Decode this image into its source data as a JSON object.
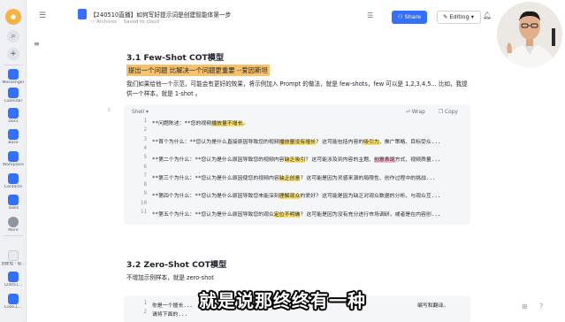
{
  "rail": {
    "items": [
      {
        "label": "Messenger",
        "color": "#3370ff"
      },
      {
        "label": "Calendar",
        "color": "#3370ff"
      },
      {
        "label": "Docs",
        "color": "#3370ff"
      },
      {
        "label": "Base",
        "color": "#3370ff"
      },
      {
        "label": "Workplace",
        "color": "#3370ff"
      },
      {
        "label": "Contacts",
        "color": "#3370ff"
      },
      {
        "label": "Tasks",
        "color": "#3370ff"
      },
      {
        "label": "More",
        "color": "#3370ff"
      }
    ],
    "bottom": [
      {
        "label": "创建电 - 提..."
      },
      {
        "label": "[24051..."
      },
      {
        "label": "Coze工..."
      }
    ]
  },
  "header": {
    "title": "【240510直播】如何写好提示词是创建智能体第一步",
    "breadcrumb": "Archives",
    "saved": "Saved to cloud",
    "share_label": "Share",
    "editing_label": "Editing"
  },
  "doc": {
    "h31": "3.1 Few-Shot COT模型",
    "highlight": "提出一个问题 比解决一个问题更重要 --爱因斯坦",
    "para1": "我们如果给他一个示范，可能会有更好的效果，将示例加入 Prompt 的做法，就是 few-shots，few 可以是 1,2,3,4,5... 比如，我提供一个样本，就是 1-shot 。",
    "code": {
      "lang": "Shell",
      "wrap": "Wrap",
      "copy": "Copy",
      "lines": [
        {
          "n": "1",
          "segs": [
            [
              "t",
              "**问题陈述：**您的视频"
            ],
            [
              "y",
              "播放量不增长"
            ],
            [
              "t",
              "。"
            ]
          ]
        },
        {
          "n": "2",
          "segs": []
        },
        {
          "n": "3",
          "segs": [
            [
              "t",
              "**首个为什么：**您认为是什么直接原因导致您的视频"
            ],
            [
              "y",
              "播放量没有增长"
            ],
            [
              "t",
              "? 这可能包括内容的"
            ],
            [
              "y",
              "吸引力"
            ],
            [
              "t",
              "、推广策略、目标受众..."
            ]
          ]
        },
        {
          "n": "4",
          "segs": []
        },
        {
          "n": "5",
          "segs": [
            [
              "t",
              "**第二个为什么：**您认为是什么原因导致您的视频内容"
            ],
            [
              "y",
              "缺乏吸引"
            ],
            [
              "t",
              "? 这可能涉及到内容的主题、"
            ],
            [
              "p",
              "创意表现"
            ],
            [
              "t",
              "方式、视频质量..."
            ]
          ]
        },
        {
          "n": "6",
          "segs": []
        },
        {
          "n": "7",
          "segs": [
            [
              "t",
              "**第三个为什么：**您认为是什么原因使您的视频内容"
            ],
            [
              "y",
              "缺乏创意"
            ],
            [
              "t",
              "? 这可能是因为灵感来源的局限性、创作过程中的挑战..."
            ]
          ]
        },
        {
          "n": "8",
          "segs": []
        },
        {
          "n": "9",
          "segs": [
            [
              "t",
              "**第四个为什么：**您认为是什么原因导致您未能深刻"
            ],
            [
              "y",
              "理解观众"
            ],
            [
              "t",
              "的爱好? 这可能是因为缺乏对观众数据的分析、与观众互..."
            ]
          ]
        },
        {
          "n": "10",
          "segs": []
        },
        {
          "n": "11",
          "segs": [
            [
              "t",
              "**第五个为什么：**您认为是什么原因导致您的观众"
            ],
            [
              "y",
              "定位不明确"
            ],
            [
              "t",
              "? 这可能是因为没有充分进行市场调研，或者是在内容创..."
            ]
          ]
        }
      ]
    },
    "h32": "3.2 Zero-Shot COT模型",
    "para2": "不增加示例样本，就是 zero-shot",
    "code2_lines": [
      {
        "n": "1",
        "text": "你是一个擅长..."
      },
      {
        "n": "2",
        "text": "请将下面的..."
      }
    ],
    "code2_tail": "编写和翻译。"
  },
  "subtitle": "就是说那终终有一种"
}
